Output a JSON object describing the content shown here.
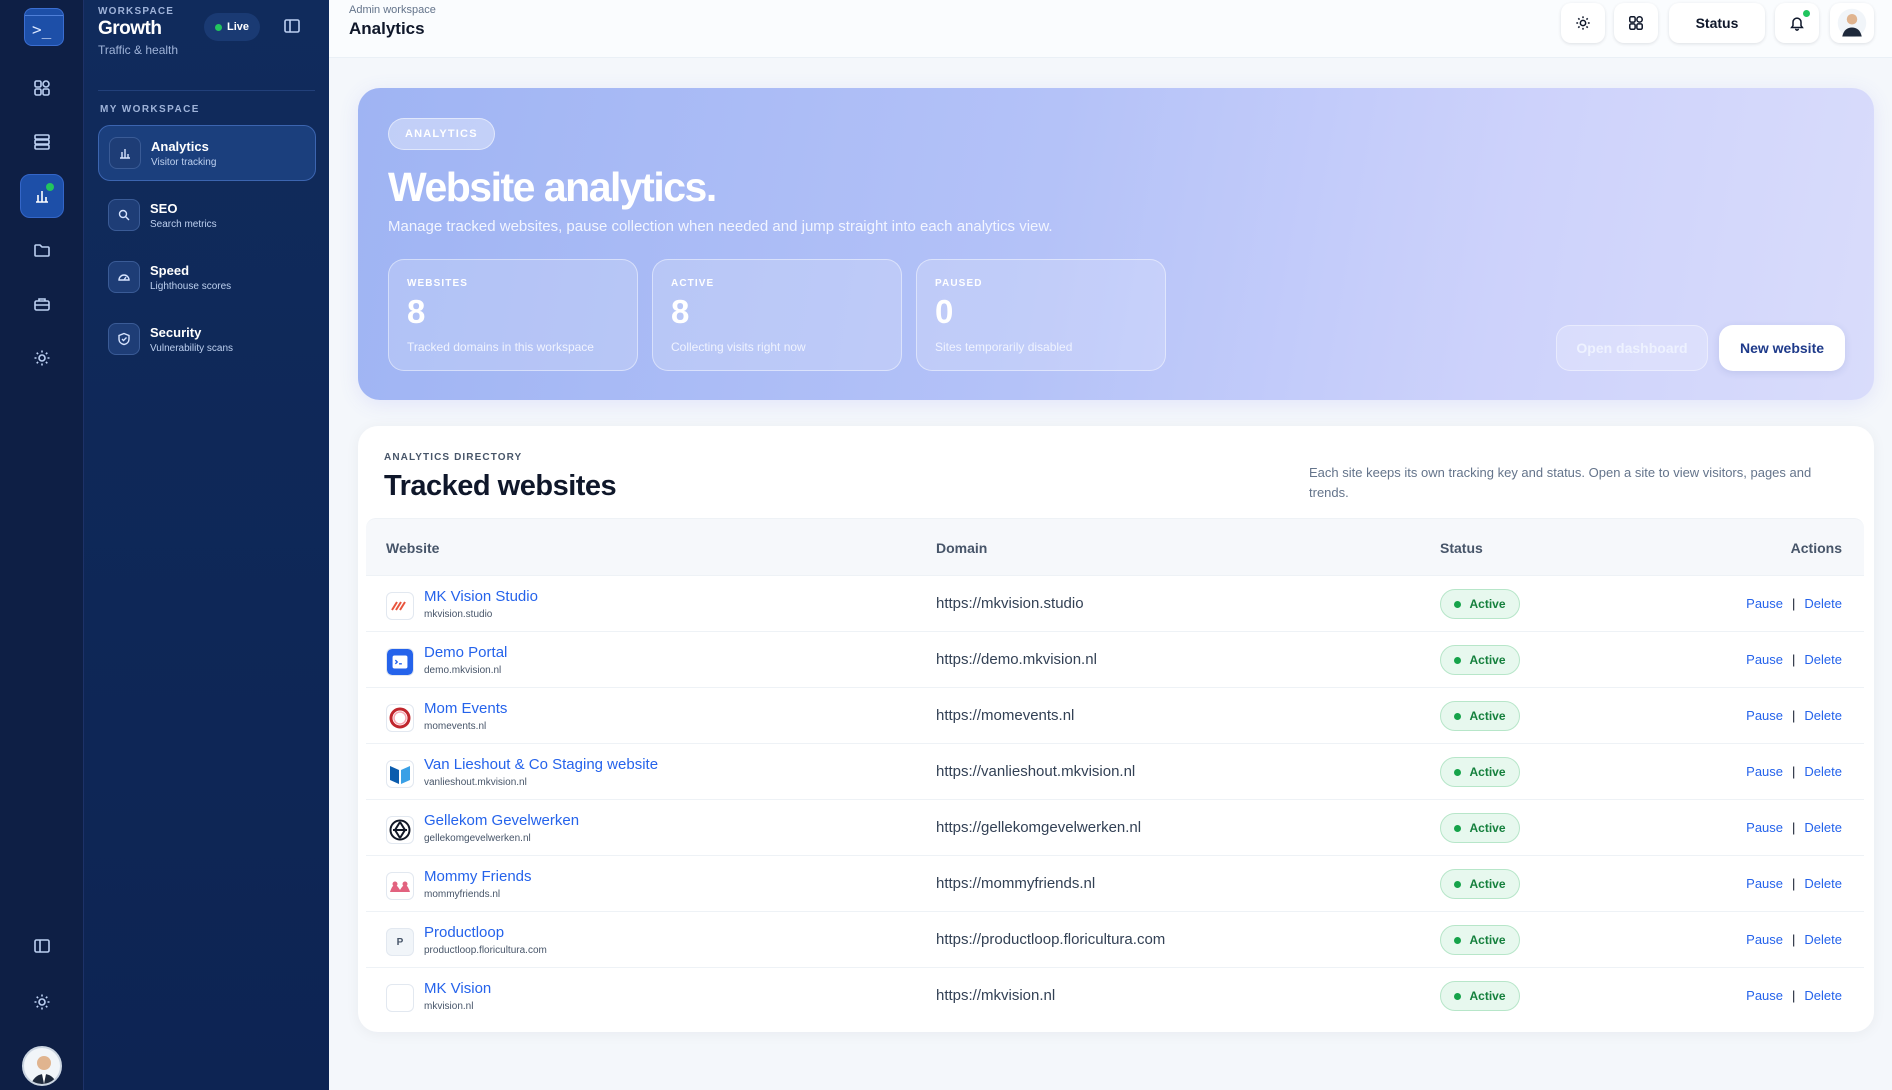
{
  "rail": {
    "logo_glyph": ">_",
    "icons": [
      "dashboard-icon",
      "database-icon",
      "analytics-icon",
      "folder-icon",
      "briefcase-icon",
      "sun-icon",
      "sidebar-toggle-icon",
      "settings-icon"
    ]
  },
  "sidebar": {
    "eyebrow": "WORKSPACE",
    "title": "Growth",
    "subtitle": "Traffic & health",
    "live_label": "Live",
    "section_label": "MY WORKSPACE",
    "items": [
      {
        "label": "Analytics",
        "sub": "Visitor tracking",
        "icon": "chart-icon"
      },
      {
        "label": "SEO",
        "sub": "Search metrics",
        "icon": "search-icon"
      },
      {
        "label": "Speed",
        "sub": "Lighthouse scores",
        "icon": "gauge-icon"
      },
      {
        "label": "Security",
        "sub": "Vulnerability scans",
        "icon": "shield-icon"
      }
    ]
  },
  "topbar": {
    "breadcrumb": "Admin workspace",
    "title": "Analytics",
    "status_label": "Status"
  },
  "hero": {
    "pill": "ANALYTICS",
    "title": "Website analytics.",
    "subtitle": "Manage tracked websites, pause collection when needed and jump straight into each analytics view.",
    "stats": [
      {
        "label": "WEBSITES",
        "value": "8",
        "desc": "Tracked domains in this workspace"
      },
      {
        "label": "ACTIVE",
        "value": "8",
        "desc": "Collecting visits right now"
      },
      {
        "label": "PAUSED",
        "value": "0",
        "desc": "Sites temporarily disabled"
      }
    ],
    "open_dashboard": "Open dashboard",
    "new_website": "New website"
  },
  "directory": {
    "eyebrow": "ANALYTICS DIRECTORY",
    "title": "Tracked websites",
    "description": "Each site keeps its own tracking key and status. Open a site to view visitors, pages and trends.",
    "columns": {
      "website": "Website",
      "domain": "Domain",
      "status": "Status",
      "actions": "Actions"
    },
    "pause_label": "Pause",
    "delete_label": "Delete",
    "rows": [
      {
        "name": "MK Vision Studio",
        "host": "mkvision.studio",
        "domain": "https://mkvision.studio",
        "status": "Active",
        "logo": "mk-studio",
        "logo_color": "#e8553d"
      },
      {
        "name": "Demo Portal",
        "host": "demo.mkvision.nl",
        "domain": "https://demo.mkvision.nl",
        "status": "Active",
        "logo": "terminal",
        "logo_color": "#2563eb"
      },
      {
        "name": "Mom Events",
        "host": "momevents.nl",
        "domain": "https://momevents.nl",
        "status": "Active",
        "logo": "ring",
        "logo_color": "#c0262d"
      },
      {
        "name": "Van Lieshout & Co Staging website",
        "host": "vanlieshout.mkvision.nl",
        "domain": "https://vanlieshout.mkvision.nl",
        "status": "Active",
        "logo": "blue-shape",
        "logo_color": "#0b5cad"
      },
      {
        "name": "Gellekom Gevelwerken",
        "host": "gellekomgevelwerken.nl",
        "domain": "https://gellekomgevelwerken.nl",
        "status": "Active",
        "logo": "geometric",
        "logo_color": "#111827"
      },
      {
        "name": "Mommy Friends",
        "host": "mommyfriends.nl",
        "domain": "https://mommyfriends.nl",
        "status": "Active",
        "logo": "pink",
        "logo_color": "#e2627f"
      },
      {
        "name": "Productloop",
        "host": "productloop.floricultura.com",
        "domain": "https://productloop.floricultura.com",
        "status": "Active",
        "logo": "letter",
        "logo_letter": "P",
        "logo_color": "#64748b"
      },
      {
        "name": "MK Vision",
        "host": "mkvision.nl",
        "domain": "https://mkvision.nl",
        "status": "Active",
        "logo": "blank",
        "logo_color": "#ffffff"
      }
    ]
  }
}
